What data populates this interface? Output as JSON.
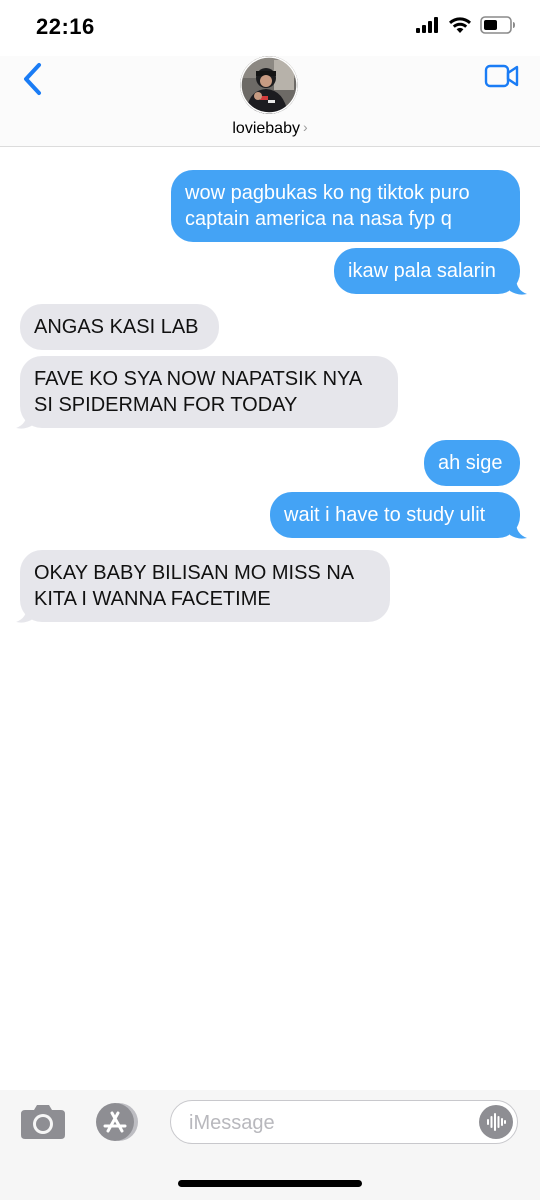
{
  "status_bar": {
    "time": "22:16",
    "icons": [
      "cellular-signal-icon",
      "wifi-icon",
      "battery-icon"
    ]
  },
  "header": {
    "back_icon": "chevron-left-icon",
    "contact_name": "loviebaby",
    "contact_chevron": "›",
    "video_icon": "video-camera-icon"
  },
  "messages": [
    {
      "direction": "sent",
      "lines": [
        "wow pagbukas ko ng tiktok puro",
        "captain america na nasa fyp q"
      ]
    },
    {
      "direction": "sent",
      "lines": [
        "ikaw pala salarin"
      ]
    },
    {
      "direction": "received",
      "lines": [
        "ANGAS KASI LAB"
      ]
    },
    {
      "direction": "received",
      "lines": [
        "FAVE KO SYA NOW NAPATSIK NYA",
        "SI SPIDERMAN FOR TODAY"
      ]
    },
    {
      "direction": "sent",
      "lines": [
        "ah sige"
      ]
    },
    {
      "direction": "sent",
      "lines": [
        "wait i have to study ulit"
      ]
    },
    {
      "direction": "received",
      "lines": [
        "OKAY BABY BILISAN MO MISS NA",
        "KITA I WANNA FACETIME"
      ]
    }
  ],
  "input_bar": {
    "camera_icon": "camera-icon",
    "appstore_icon": "app-store-icon",
    "placeholder": "iMessage",
    "audio_icon": "audio-waveform-icon"
  },
  "colors": {
    "sent_bubble": "#44a3f5",
    "received_bubble": "#e6e6eb",
    "accent": "#1a7cf5"
  }
}
